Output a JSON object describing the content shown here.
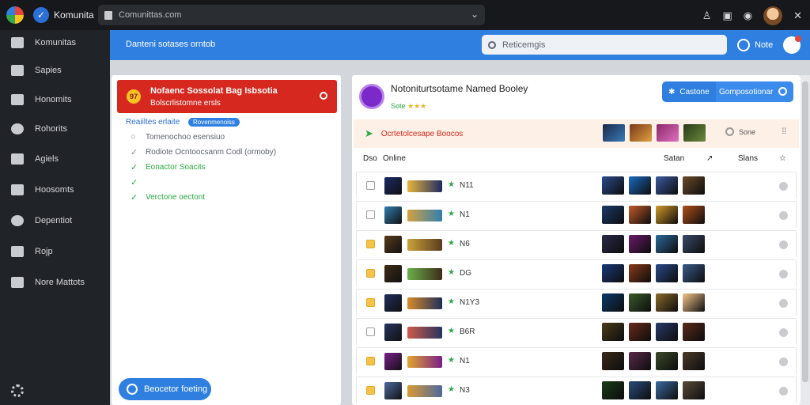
{
  "topbar": {
    "brand": "Komunita",
    "address": "Comunittas.com"
  },
  "sidebar": {
    "items": [
      {
        "label": "Komunitas"
      },
      {
        "label": "Sapies"
      },
      {
        "label": "Honomits"
      },
      {
        "label": "Rohorits"
      },
      {
        "label": "Agiels"
      },
      {
        "label": "Hoosomts"
      },
      {
        "label": "Depentiot"
      },
      {
        "label": "Rojp"
      },
      {
        "label": "Nore Mattots"
      }
    ]
  },
  "header": {
    "title": "Danteni sotases orntob",
    "search_placeholder": "Reticemgis",
    "note_label": "Note"
  },
  "left_panel": {
    "alert": {
      "icon_text": "97",
      "title": "Nofaenc Sossolat Bag Isbsotia",
      "subtitle": "Bolscrlistomne ersls"
    },
    "requests_label": "Reaiiltes erlaite",
    "requests_badge": "Rovenmenoiss",
    "checklist": [
      {
        "text": "Tomenochoo esensiuo",
        "state": "gray"
      },
      {
        "text": "Rodiote Ocntoocsanm Codl (ormoby)",
        "state": "gray"
      },
      {
        "text": "Eonactor Soacits",
        "state": "green"
      },
      {
        "text": "",
        "state": "green"
      },
      {
        "text": "Verctone oectont",
        "state": "green"
      }
    ],
    "fab_label": "Beocetor foeting"
  },
  "right_panel": {
    "game_title": "Notoniturtsotame Named Booley",
    "game_subtitle": "Sote",
    "rating_stars": "★★★",
    "btn_left": "Castone",
    "btn_right": "Gomposotionar",
    "promo_text": "Ocrtetolcesape Boocos",
    "see_label": "Sone",
    "columns": {
      "c1": "Dso",
      "c2": "Online",
      "c3": "Satan",
      "c4": "Slans"
    },
    "rows": [
      {
        "value": "N11",
        "checked": false,
        "colors": [
          "#1c2a66",
          "#e8b63a"
        ]
      },
      {
        "value": "N1",
        "checked": false,
        "colors": [
          "#2e7fb0",
          "#d6a23e"
        ]
      },
      {
        "value": "N6",
        "checked": true,
        "colors": [
          "#5a3b1e",
          "#caa23a"
        ]
      },
      {
        "value": "DG",
        "checked": true,
        "colors": [
          "#3e2c18",
          "#6ab04a"
        ]
      },
      {
        "value": "N1Y3",
        "checked": true,
        "colors": [
          "#1e2e5a",
          "#d88b2a"
        ]
      },
      {
        "value": "B6R",
        "checked": false,
        "colors": [
          "#26345e",
          "#cf5a4a"
        ]
      },
      {
        "value": "N1",
        "checked": true,
        "colors": [
          "#7a1f8a",
          "#e2a52e"
        ]
      },
      {
        "value": "N3",
        "checked": true,
        "colors": [
          "#4d6a9e",
          "#d99a32"
        ]
      }
    ]
  },
  "colors": {
    "accent": "#2f7fe0",
    "alert": "#d6281e",
    "success": "#2aa843"
  }
}
